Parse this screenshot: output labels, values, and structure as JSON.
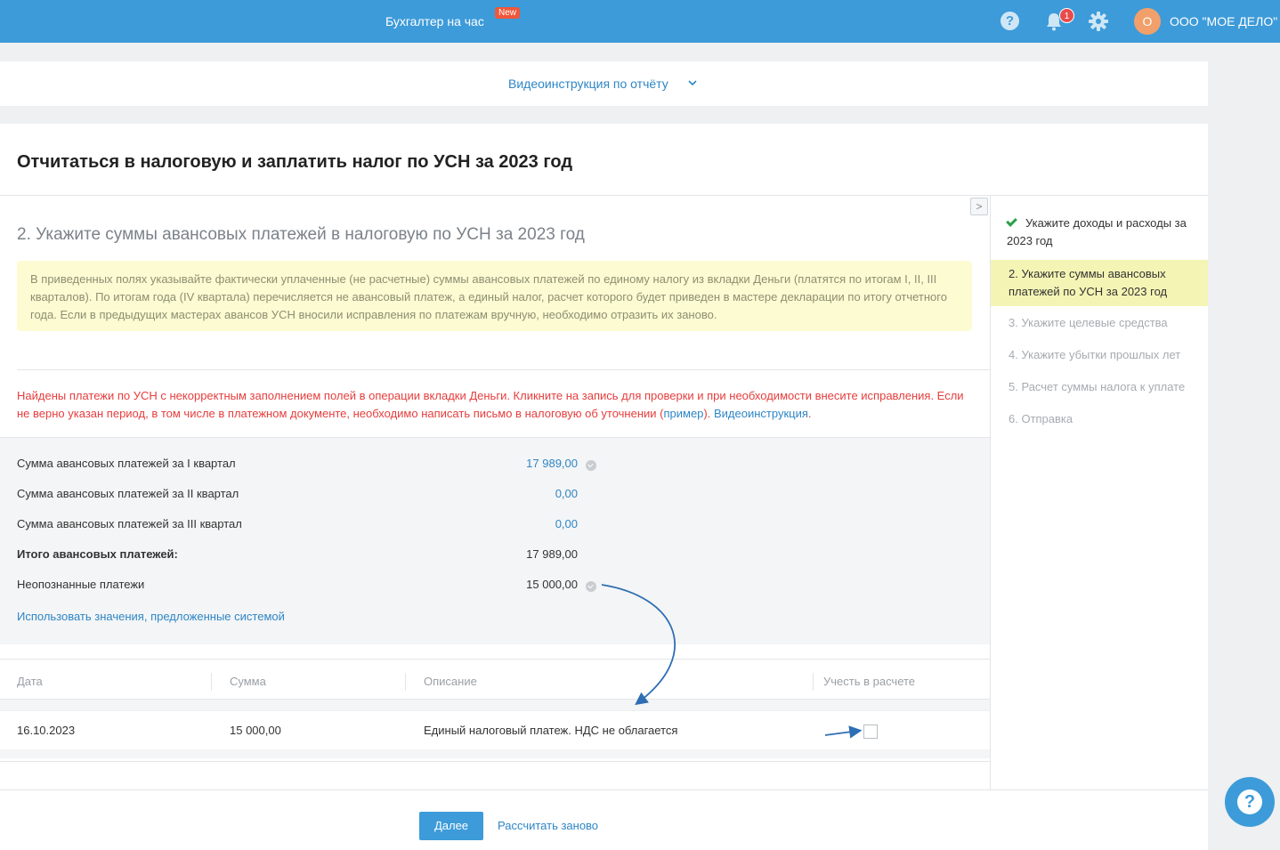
{
  "topbar": {
    "service": "Бухгалтер на час",
    "new_badge": "New",
    "notif_count": "1",
    "avatar_letter": "О",
    "company": "ООО \"МОЕ ДЕЛО\""
  },
  "video_bar": {
    "link": "Видеоинструкция по отчёту"
  },
  "page_title": "Отчитаться в налоговую и заплатить налог по УСН за 2023 год",
  "step": {
    "heading": "2. Укажите суммы авансовых платежей в налоговую по УСН за 2023 год",
    "info": "В приведенных полях указывайте фактически уплаченные (не расчетные) суммы авансовых платежей по единому налогу из вкладки Деньги (платятся по итогам I, II, III кварталов). По итогам года (IV квартала) перечисляется не авансовый платеж, а единый налог, расчет которого будет приведен в мастере декларации по итогу отчетного года. Если в предыдущих мастерах авансов УСН вносили исправления по платежам вручную, необходимо отразить их заново.",
    "warning_text": "Найдены платежи по УСН с некорректным заполнением полей в операции вкладки Деньги. Кликните на запись для проверки и при необходимости внесите исправления. Если не верно указан период, в том числе в платежном документе, необходимо написать письмо в налоговую об уточнении (",
    "warning_example": "пример",
    "warning_mid": "). ",
    "warning_video": "Видеоинструкция",
    "warning_end": "."
  },
  "sums": {
    "q1_label": "Сумма авансовых платежей за I квартал",
    "q1_value": "17 989,00",
    "q2_label": "Сумма авансовых платежей за II квартал",
    "q2_value": "0,00",
    "q3_label": "Сумма авансовых платежей за III квартал",
    "q3_value": "0,00",
    "total_label": "Итого авансовых платежей:",
    "total_value": "17 989,00",
    "unknown_label": "Неопознанные платежи",
    "unknown_value": "15 000,00",
    "use_link": "Использовать значения, предложенные системой"
  },
  "table": {
    "headers": [
      "Дата",
      "Сумма",
      "Описание",
      "Учесть в расчете"
    ],
    "rows": [
      {
        "date": "16.10.2023",
        "sum": "15 000,00",
        "description": "Единый налоговый платеж. НДС не облагается",
        "checked": false
      }
    ]
  },
  "sidebar": {
    "steps": [
      {
        "label": "Укажите доходы и расходы за 2023 год",
        "state": "done"
      },
      {
        "label": "2.  Укажите суммы авансовых платежей по УСН за 2023 год",
        "state": "active"
      },
      {
        "label": "3.  Укажите целевые средства",
        "state": "todo"
      },
      {
        "label": "4.  Укажите убытки прошлых лет",
        "state": "todo"
      },
      {
        "label": "5.  Расчет суммы налога к уплате",
        "state": "todo"
      },
      {
        "label": "6.  Отправка",
        "state": "todo"
      }
    ]
  },
  "buttons": {
    "next": "Далее",
    "recalc": "Рассчитать заново"
  },
  "colors": {
    "accent": "#3d9bd9",
    "link": "#2e86c6",
    "error": "#e63d3d",
    "highlight": "#f4f5b5"
  }
}
